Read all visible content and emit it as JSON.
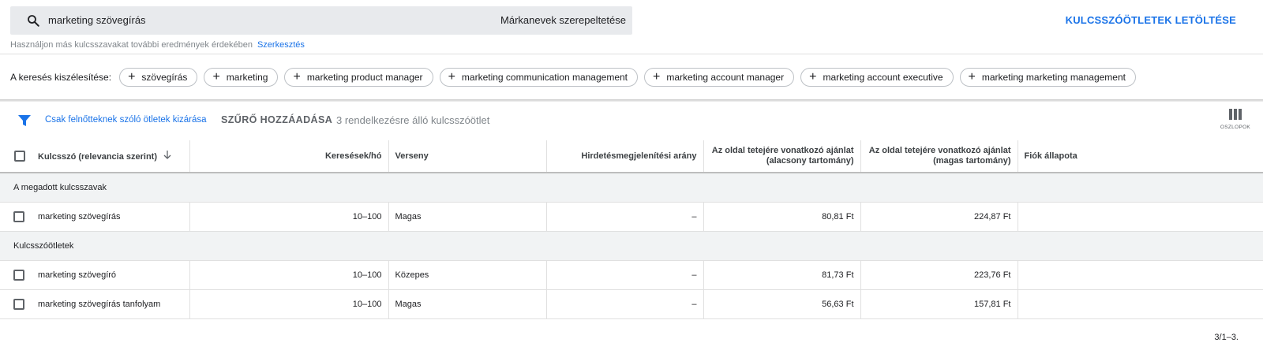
{
  "search": {
    "query": "marketing szövegírás",
    "brand_toggle": "Márkanevek szerepeltetése"
  },
  "download_label": "KULCSSZÓÖTLETEK LETÖLTÉSE",
  "hint": {
    "text": "Használjon más kulcsszavakat további eredmények érdekében",
    "edit": "Szerkesztés"
  },
  "broaden": {
    "label": "A keresés kiszélesítése:",
    "chips": [
      "szövegírás",
      "marketing",
      "marketing product manager",
      "marketing communication management",
      "marketing account manager",
      "marketing account executive",
      "marketing marketing management"
    ]
  },
  "filter_bar": {
    "adult_exclude": "Csak felnőtteknek szóló ötletek kizárása",
    "add_filter": "SZŰRŐ HOZZÁADÁSA",
    "count_text": "3 rendelkezésre álló kulcsszóötlet",
    "columns_label": "OSZLOPOK"
  },
  "table": {
    "headers": {
      "keyword": "Kulcsszó (relevancia szerint)",
      "searches": "Keresések/hó",
      "competition": "Verseny",
      "impression_share": "Hirdetésmegjelenítési arány",
      "bid_low_line1": "Az oldal tetejére vonatkozó ajánlat",
      "bid_low_line2": "(alacsony tartomány)",
      "bid_high_line1": "Az oldal tetejére vonatkozó ajánlat",
      "bid_high_line2": "(magas tartomány)",
      "account_status": "Fiók állapota"
    },
    "groups": {
      "provided": "A megadott kulcsszavak",
      "ideas": "Kulcsszóötletek"
    },
    "rows": [
      {
        "keyword": "marketing szövegírás",
        "searches": "10–100",
        "competition": "Magas",
        "impression_share": "–",
        "bid_low": "80,81 Ft",
        "bid_high": "224,87 Ft"
      },
      {
        "keyword": "marketing szövegíró",
        "searches": "10–100",
        "competition": "Közepes",
        "impression_share": "–",
        "bid_low": "81,73 Ft",
        "bid_high": "223,76 Ft"
      },
      {
        "keyword": "marketing szövegírás tanfolyam",
        "searches": "10–100",
        "competition": "Magas",
        "impression_share": "–",
        "bid_low": "56,63 Ft",
        "bid_high": "157,81 Ft"
      }
    ]
  },
  "pager": "3/1–3.",
  "colors": {
    "accent": "#1a73e8",
    "search_bg": "#e8eaed",
    "group_bg": "#f1f3f4"
  },
  "icons": [
    "search-icon",
    "filter-icon",
    "columns-icon",
    "checkbox",
    "sort-arrow-down-icon",
    "plus-icon"
  ]
}
